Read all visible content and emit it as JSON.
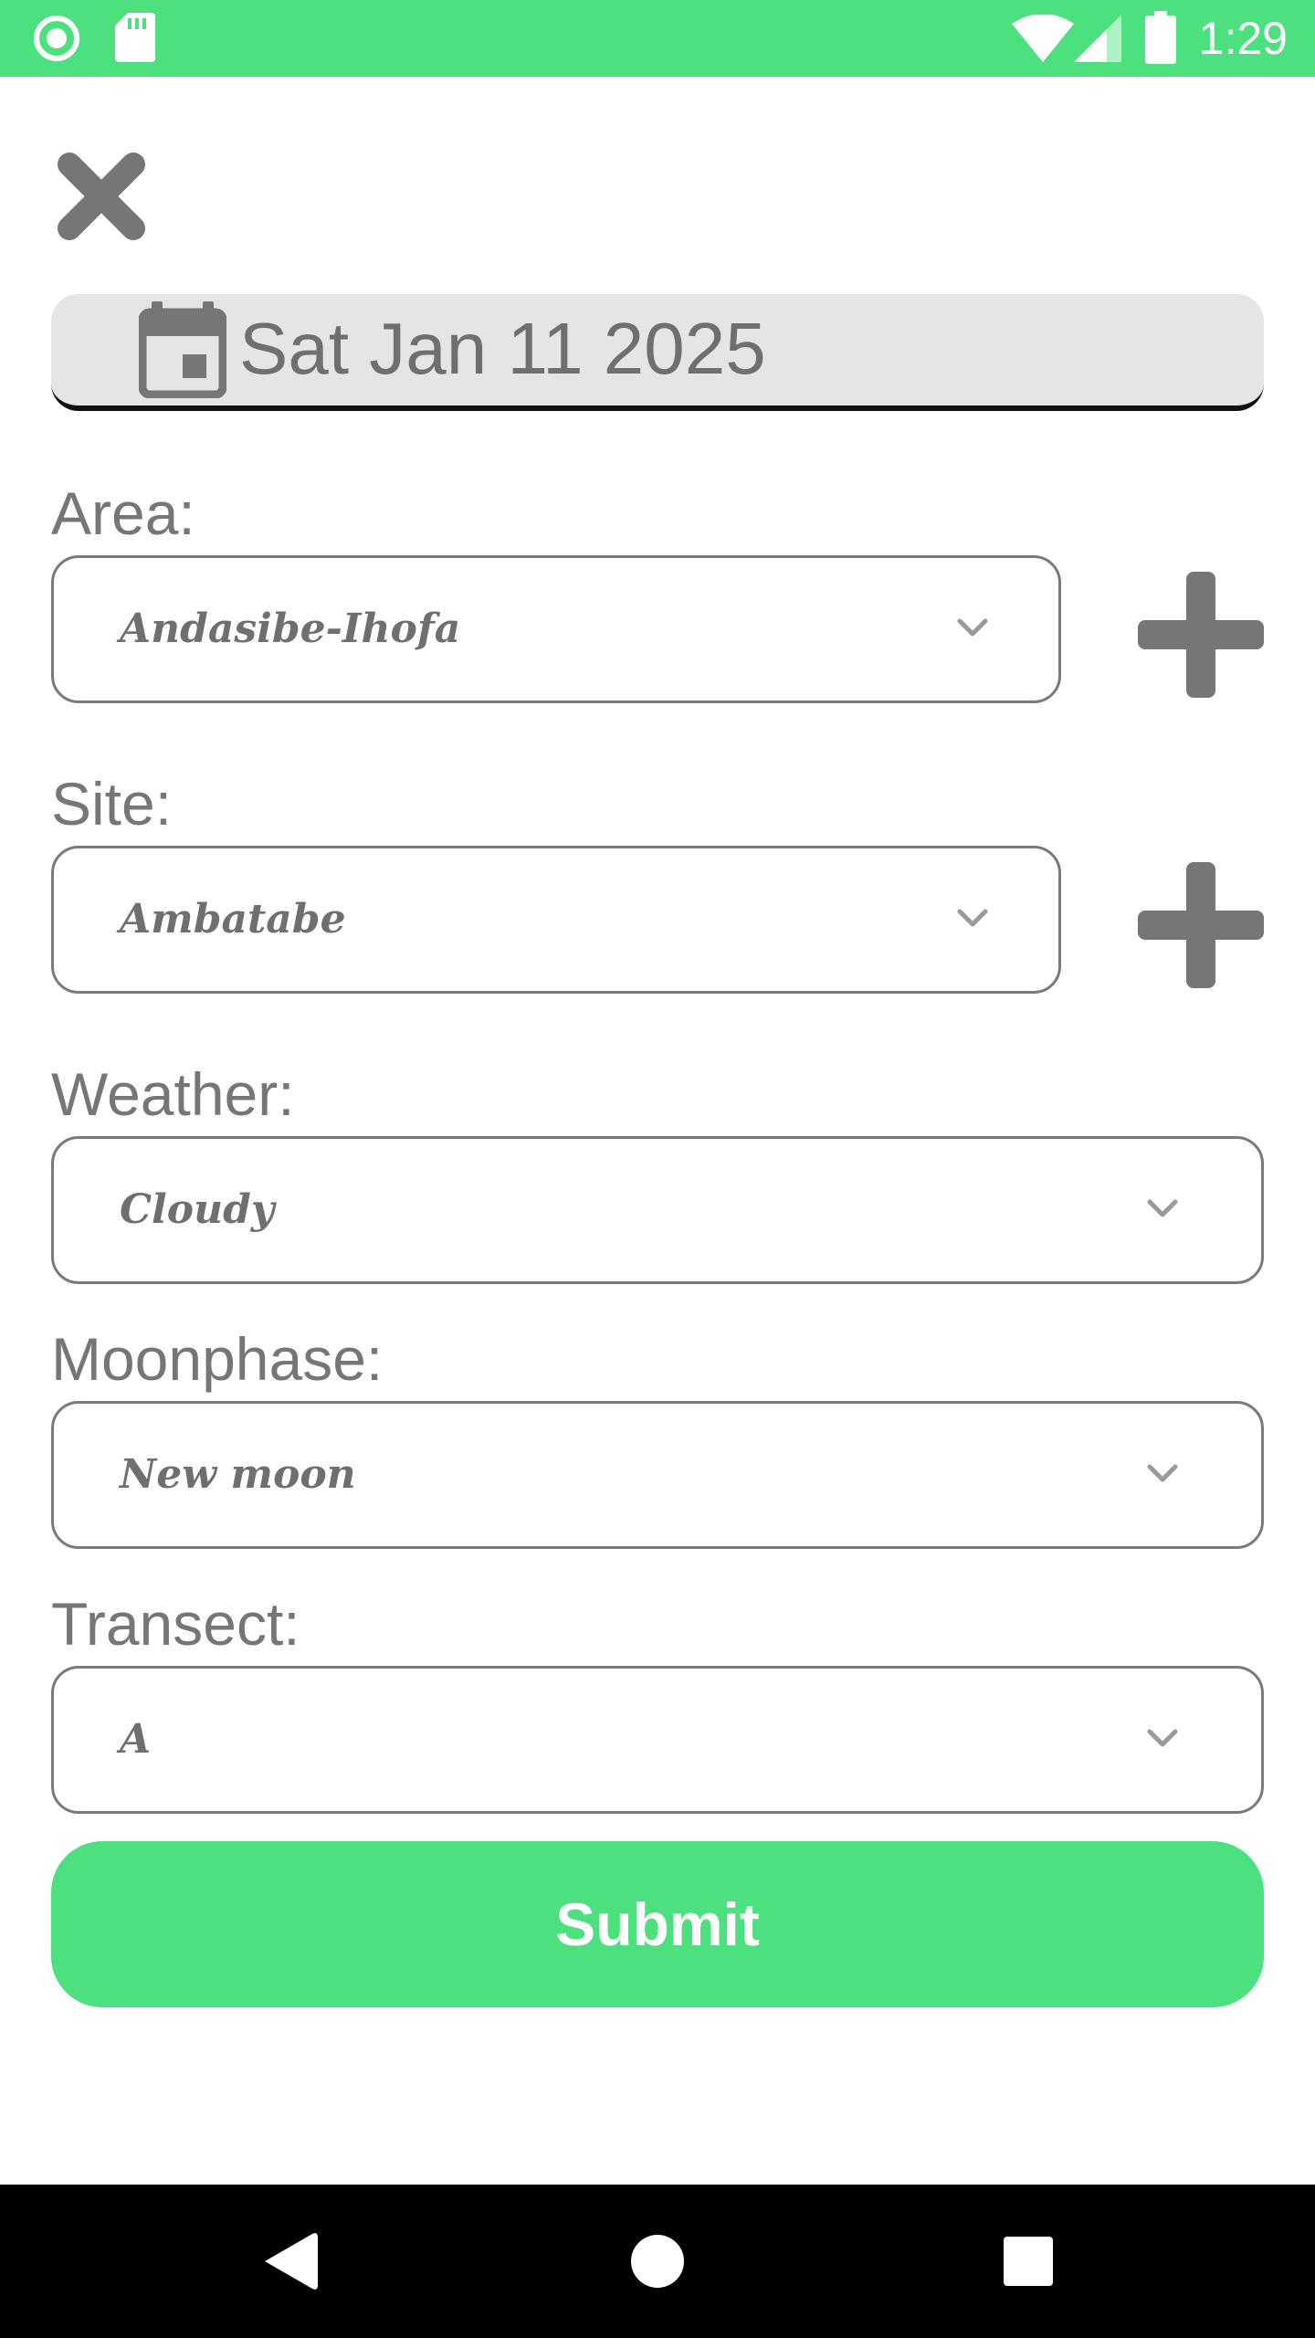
{
  "status_bar": {
    "time": "1:29",
    "background": "#4de07f",
    "left_icons": [
      "record-icon",
      "sd-card-icon"
    ],
    "right_icons": [
      "wifi-icon",
      "cell-signal-icon",
      "battery-icon"
    ]
  },
  "date_field": {
    "value": "Sat Jan 11 2025",
    "icon": "calendar-icon"
  },
  "fields": {
    "area": {
      "label": "Area:",
      "value": "Andasibe-Ihofa"
    },
    "site": {
      "label": "Site:",
      "value": "Ambatabe"
    },
    "weather": {
      "label": "Weather:",
      "value": "Cloudy"
    },
    "moonphase": {
      "label": "Moonphase:",
      "value": "New moon"
    },
    "transect": {
      "label": "Transect:",
      "value": "A"
    }
  },
  "submit": {
    "label": "Submit"
  },
  "colors": {
    "accent": "#4de07f",
    "icon_gray": "#767676",
    "date_field_bg": "#e5e5e5"
  },
  "nav_bar": {
    "buttons": [
      "back-icon",
      "home-icon",
      "recents-icon"
    ]
  }
}
